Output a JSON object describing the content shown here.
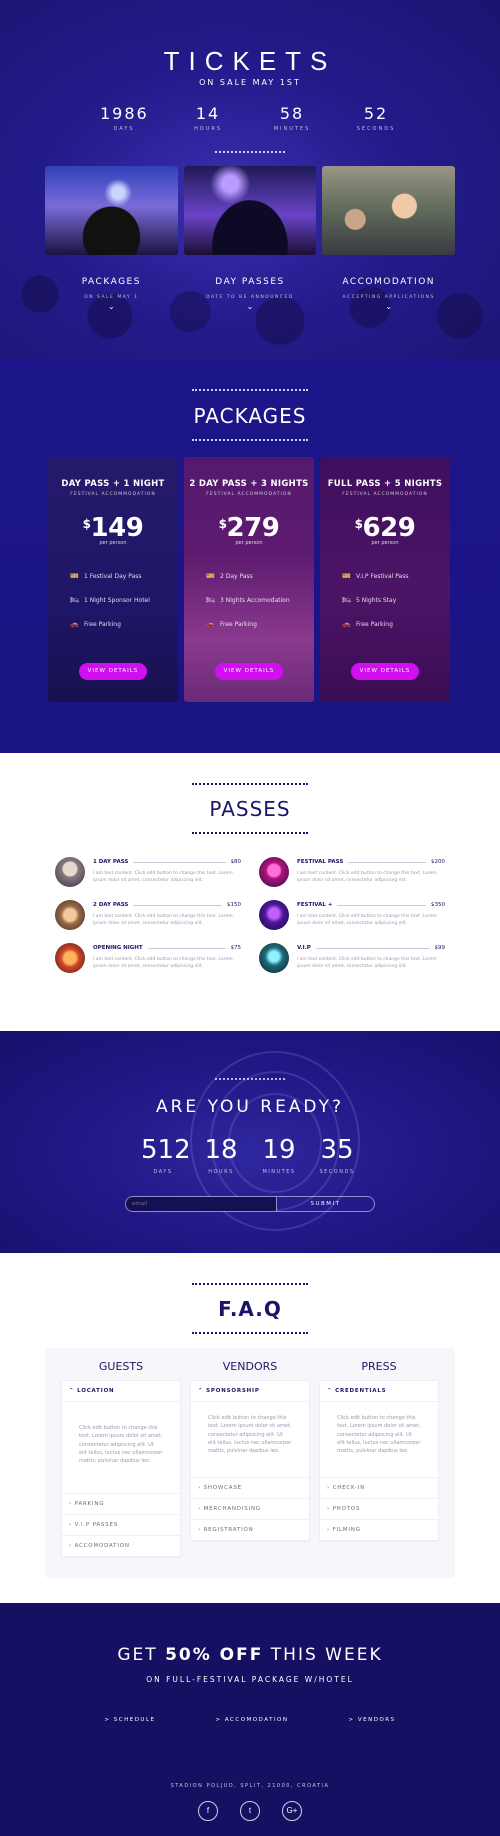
{
  "hero": {
    "title": "TICKETS",
    "subtitle": "ON SALE MAY 1ST",
    "countdown": [
      {
        "value": "1986",
        "label": "DAYS"
      },
      {
        "value": "14",
        "label": "HOURS"
      },
      {
        "value": "58",
        "label": "MINUTES"
      },
      {
        "value": "52",
        "label": "SECONDS"
      }
    ],
    "cards": [
      {
        "title": "PACKAGES",
        "sub": "ON SALE MAY 1"
      },
      {
        "title": "DAY PASSES",
        "sub": "DATE TO BE ANNOUNCED"
      },
      {
        "title": "ACCOMODATION",
        "sub": "ACCEPTING APPLICATIONS"
      }
    ],
    "chevron": "⌄"
  },
  "packages": {
    "title": "PACKAGES",
    "items": [
      {
        "name": "DAY PASS + 1 NIGHT",
        "sub": "FESTIVAL ACCOMMODATION",
        "currency": "$",
        "price": "149",
        "per": "per person",
        "features": [
          "1 Festival Day Pass",
          "1 Night Sponsor Hotel",
          "Free Parking"
        ],
        "button": "VIEW DETAILS"
      },
      {
        "name": "2 DAY PASS + 3 NIGHTS",
        "sub": "FESTIVAL ACCOMMODATION",
        "currency": "$",
        "price": "279",
        "per": "per person",
        "features": [
          "2 Day Pass",
          "3 Nights Accomodation",
          "Free Parking"
        ],
        "button": "VIEW DETAILS"
      },
      {
        "name": "FULL PASS + 5 NIGHTS",
        "sub": "FESTIVAL ACCOMMODATION",
        "currency": "$",
        "price": "629",
        "per": "per person",
        "features": [
          "V.I.P Festival Pass",
          "5 Nights Stay",
          "Free Parking"
        ],
        "button": "VIEW DETAILS"
      }
    ]
  },
  "passes": {
    "title": "PASSES",
    "desc": "I am text content. Click edit button to change this text. Lorem ipsum dolor sit amet, consectetur adipiscing elit.",
    "items": [
      {
        "name": "1 DAY PASS",
        "price": "$80"
      },
      {
        "name": "FESTIVAL PASS",
        "price": "$200"
      },
      {
        "name": "2 DAY PASS",
        "price": "$150"
      },
      {
        "name": "FESTIVAL +",
        "price": "$350"
      },
      {
        "name": "OPENING NIGHT",
        "price": "$75"
      },
      {
        "name": "V.I.P",
        "price": "$99"
      }
    ]
  },
  "ready": {
    "title": "ARE YOU READY?",
    "countdown": [
      {
        "value": "512",
        "label": "DAYS"
      },
      {
        "value": "18",
        "label": "HOURS"
      },
      {
        "value": "19",
        "label": "MINUTES"
      },
      {
        "value": "35",
        "label": "SECONDS"
      }
    ],
    "email_placeholder": "email",
    "submit": "SUBMIT"
  },
  "faq": {
    "title": "F.A.Q",
    "answer": "Click edit button to change this text. Lorem ipsum dolor sit amet, consectetur adipiscing elit. Ut elit tellus, luctus nec ullamcorper mattis, pulvinar dapibus leo.",
    "columns": [
      {
        "heading": "GUESTS",
        "open": "LOCATION",
        "items": [
          "PARKING",
          "V.I.P PASSES",
          "ACCOMODATION"
        ]
      },
      {
        "heading": "VENDORS",
        "open": "SPONSORSHIP",
        "items": [
          "SHOWCASE",
          "MERCHANDISING",
          "REGISTRATION"
        ]
      },
      {
        "heading": "PRESS",
        "open": "CREDENTIALS",
        "items": [
          "CHECK-IN",
          "PHOTOS",
          "FILMING"
        ]
      }
    ]
  },
  "footer": {
    "promo_pre": "GET ",
    "promo_bold": "50% OFF",
    "promo_post": " THIS WEEK",
    "promo_sub": "ON FULL-FESTIVAL PACKAGE W/HOTEL",
    "links": [
      "> SCHEDULE",
      "> ACCOMODATION",
      "> VENDORS"
    ],
    "address": "STADION POLJUD, SPLIT, 21000, CROATIA",
    "social": [
      "f",
      "t",
      "G+"
    ]
  }
}
